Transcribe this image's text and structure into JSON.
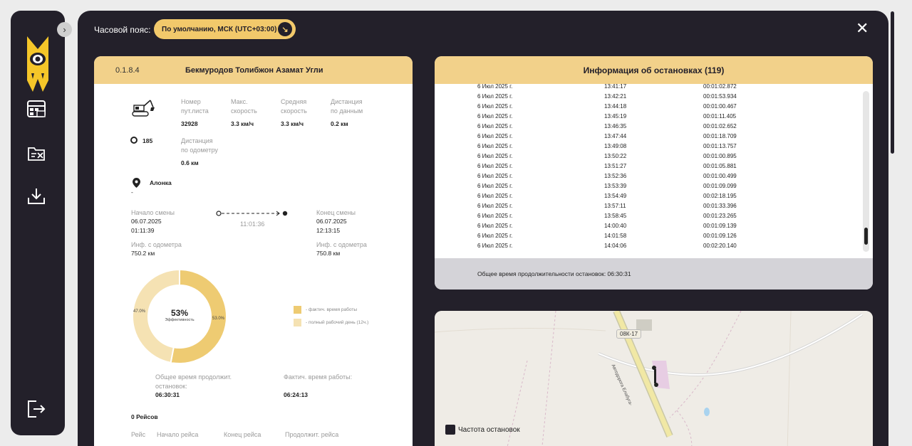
{
  "sidebar": {
    "toggle_icon": "chevron-right-icon",
    "items": [
      {
        "name": "transport-table-icon"
      },
      {
        "name": "document-cancel-icon"
      },
      {
        "name": "download-icon"
      }
    ],
    "logout_icon": "logout-icon"
  },
  "header": {
    "timezone_label": "Часовой пояс:",
    "timezone_value": "По умолчанию, МСК (UTC+03:00)"
  },
  "left_card": {
    "version": "0.1.8.4",
    "driver_name": "Бекмуродов Толибжон Азамат Угли",
    "vehicle_icon": "excavator-icon",
    "vehicle_number": "185",
    "fields": {
      "waybill_label_1": "Номер",
      "waybill_label_2": "пут.листа",
      "waybill_value": "32928",
      "maxspeed_label_1": "Макс.",
      "maxspeed_label_2": "скорость",
      "maxspeed_value": "3.3 км/ч",
      "avgspeed_label_1": "Средняя",
      "avgspeed_label_2": "скорость",
      "avgspeed_value": "3.3 км/ч",
      "dist_data_label_1": "Дистанция",
      "dist_data_label_2": "по данным",
      "dist_data_value": "0.2 км",
      "dist_odo_label_1": "Дистанция",
      "dist_odo_label_2": "по одометру",
      "dist_odo_value": "0.6 км"
    },
    "location_name": "Алонка",
    "location_sub": "-",
    "shift": {
      "start_label": "Начало смены",
      "start_date": "06.07.2025",
      "start_time": "01:11:39",
      "duration": "11:01:36",
      "end_label": "Конец смены",
      "end_date": "06.07.2025",
      "end_time": "12:13:15",
      "odo_start_label": "Инф. с одометра",
      "odo_start_value": "750.2 км",
      "odo_end_label": "Инф. с одометра",
      "odo_end_value": "750.8 км"
    },
    "efficiency": {
      "percent": "53%",
      "label": "Эффективность",
      "slice_actual": 53.0,
      "slice_full": 47.0,
      "slice_actual_label": "53.0%",
      "slice_full_label": "47.0%",
      "legend_actual": "- фактич. время работы",
      "legend_full": "- полный рабочий день (12ч.)",
      "color_actual": "#eecb72",
      "color_full": "#f5e2b3"
    },
    "totals": {
      "stops_label_1": "Общее время продолжит.",
      "stops_label_2": "остановок:",
      "stops_value": "06:30:31",
      "work_label": "Фактич. время работы:",
      "work_value": "06:24:13"
    },
    "trips_count": "0 Рейсов",
    "trips_columns": [
      "Рейс",
      "Начало рейса",
      "Конец рейса",
      "Продолжит. рейса"
    ]
  },
  "stops": {
    "title": "Информация об остановках (119)",
    "rows": [
      [
        "6 Июл 2025 г.",
        "13:41:17",
        "00:01:02.872"
      ],
      [
        "6 Июл 2025 г.",
        "13:42:21",
        "00:01:53.934"
      ],
      [
        "6 Июл 2025 г.",
        "13:44:18",
        "00:01:00.467"
      ],
      [
        "6 Июл 2025 г.",
        "13:45:19",
        "00:01:11.405"
      ],
      [
        "6 Июл 2025 г.",
        "13:46:35",
        "00:01:02.652"
      ],
      [
        "6 Июл 2025 г.",
        "13:47:44",
        "00:01:18.709"
      ],
      [
        "6 Июл 2025 г.",
        "13:49:08",
        "00:01:13.757"
      ],
      [
        "6 Июл 2025 г.",
        "13:50:22",
        "00:01:00.895"
      ],
      [
        "6 Июл 2025 г.",
        "13:51:27",
        "00:01:05.881"
      ],
      [
        "6 Июл 2025 г.",
        "13:52:36",
        "00:01:00.499"
      ],
      [
        "6 Июл 2025 г.",
        "13:53:39",
        "00:01:09.099"
      ],
      [
        "6 Июл 2025 г.",
        "13:54:49",
        "00:02:18.195"
      ],
      [
        "6 Июл 2025 г.",
        "13:57:11",
        "00:01:33.396"
      ],
      [
        "6 Июл 2025 г.",
        "13:58:45",
        "00:01:23.265"
      ],
      [
        "6 Июл 2025 г.",
        "14:00:40",
        "00:01:09.139"
      ],
      [
        "6 Июл 2025 г.",
        "14:01:58",
        "00:01:09.126"
      ],
      [
        "6 Июл 2025 г.",
        "14:04:06",
        "00:02:20.140"
      ]
    ],
    "total": "Общее время продолжительности остановок: 06:30:31"
  },
  "map": {
    "road_label": "08К-17",
    "road_name": "Автодорога Елабуга-",
    "legend": "Частота остановок"
  }
}
